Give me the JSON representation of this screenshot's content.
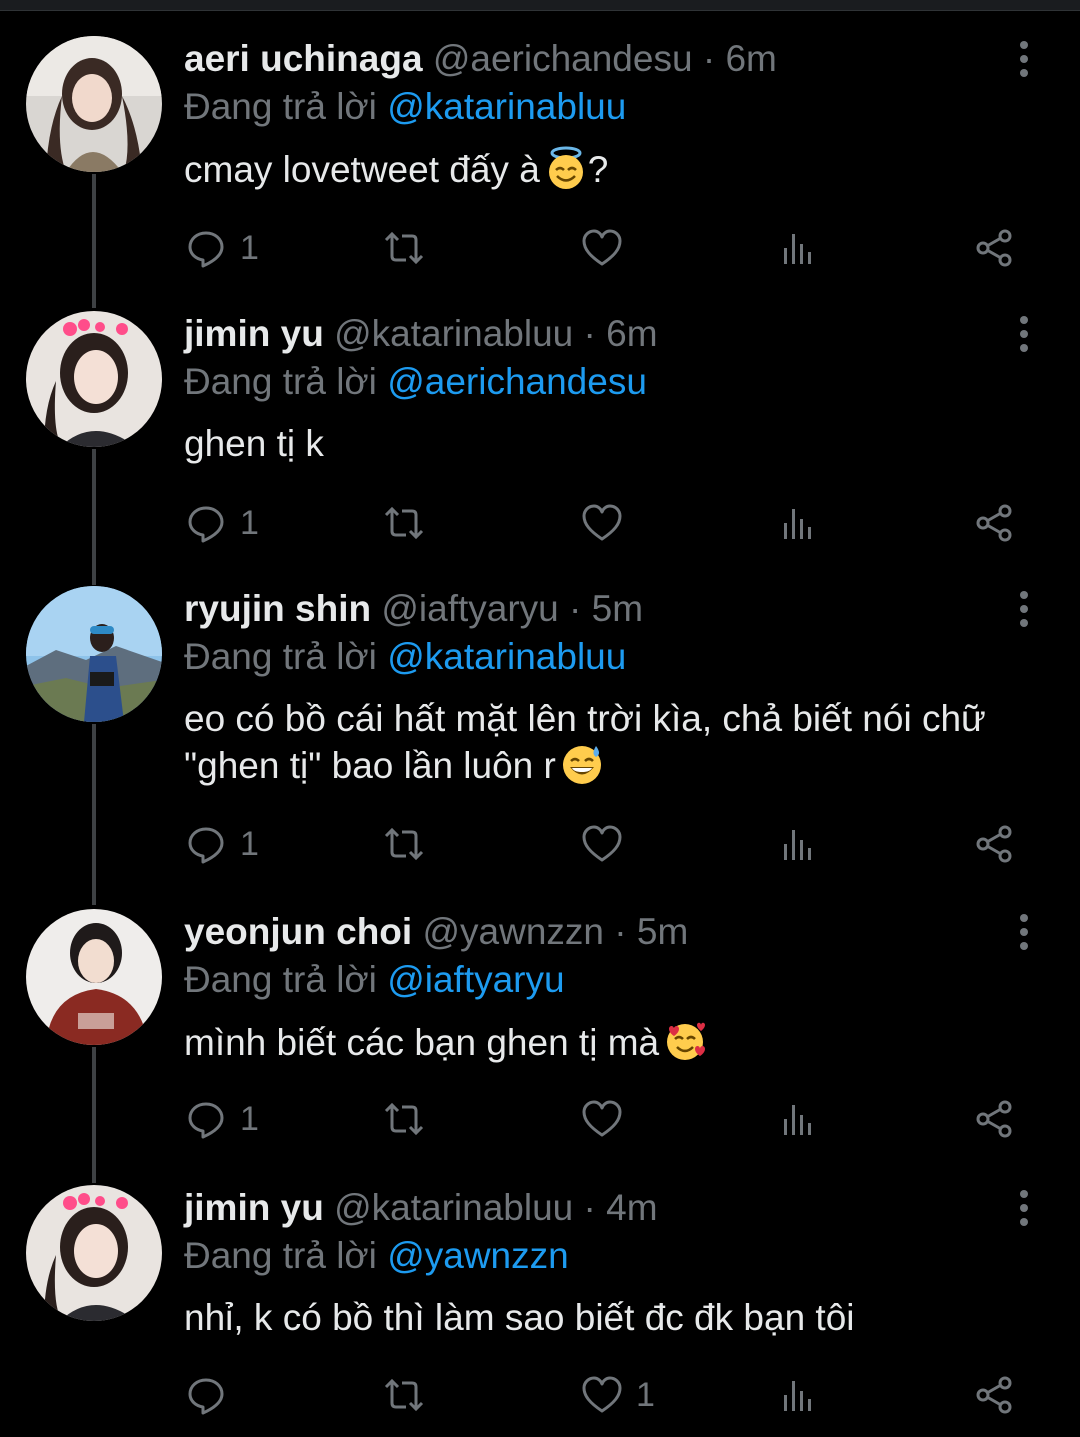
{
  "tweets": [
    {
      "name": "aeri uchinaga",
      "handle": "@aerichandesu",
      "time": "6m",
      "reply_prefix": "Đang trả lời",
      "reply_to": "@katarinabluu",
      "text": "cmay lovetweet đấy à",
      "text_suffix": "?",
      "emoji": "smiling-face-with-halo",
      "reply_count": "1",
      "like_count": ""
    },
    {
      "name": "jimin yu",
      "handle": "@katarinabluu",
      "time": "6m",
      "reply_prefix": "Đang trả lời",
      "reply_to": "@aerichandesu",
      "text": "ghen tị k",
      "text_suffix": "",
      "emoji": "",
      "reply_count": "1",
      "like_count": ""
    },
    {
      "name": "ryujin shin",
      "handle": "@iaftyaryu",
      "time": "5m",
      "reply_prefix": "Đang trả lời",
      "reply_to": "@katarinabluu",
      "text": "eo có bồ cái hất mặt lên trời kìa, chả biết nói chữ \"ghen tị\" bao lần luôn r",
      "text_suffix": "",
      "emoji": "grinning-face-with-sweat",
      "reply_count": "1",
      "like_count": ""
    },
    {
      "name": "yeonjun choi",
      "handle": "@yawnzzn",
      "time": "5m",
      "reply_prefix": "Đang trả lời",
      "reply_to": "@iaftyaryu",
      "text": "mình biết các bạn ghen tị mà",
      "text_suffix": "",
      "emoji": "smiling-face-with-hearts",
      "reply_count": "1",
      "like_count": ""
    },
    {
      "name": "jimin yu",
      "handle": "@katarinabluu",
      "time": "4m",
      "reply_prefix": "Đang trả lời",
      "reply_to": "@yawnzzn",
      "text": "nhỉ, k có bồ thì làm sao biết đc đk bạn tôi",
      "text_suffix": "",
      "emoji": "",
      "reply_count": "",
      "like_count": "1"
    }
  ],
  "separator": "·",
  "icons": [
    "reply-icon",
    "retweet-icon",
    "like-icon",
    "views-icon",
    "share-icon",
    "more-icon"
  ],
  "colors": {
    "background": "#000000",
    "text": "#e7e9ea",
    "muted": "#71767b",
    "link": "#1d9bf0"
  }
}
